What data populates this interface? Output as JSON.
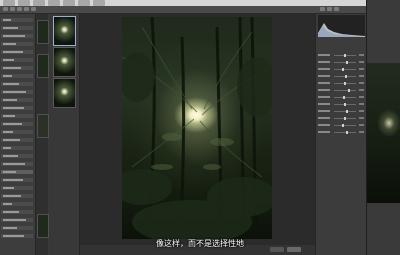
{
  "menubar": {
    "items": [
      "",
      "",
      "",
      "",
      "",
      "",
      ""
    ]
  },
  "left_panel": {
    "rows": 28
  },
  "filmstrip": {
    "thumbnails": 3,
    "selected_index": 0
  },
  "canvas": {
    "photo": "forest-photo"
  },
  "right_panel": {
    "histogram": "histogram",
    "sliders": [
      {
        "level": 0.5
      },
      {
        "level": 0.62
      },
      {
        "level": 0.4
      },
      {
        "level": 0.55
      },
      {
        "level": 0.5
      },
      {
        "level": 0.68
      },
      {
        "level": 0.45
      },
      {
        "level": 0.5
      },
      {
        "level": 0.58
      },
      {
        "level": 0.5
      },
      {
        "level": 0.42
      },
      {
        "level": 0.6
      }
    ]
  },
  "subtitle": {
    "text": "像这样，而不是选择性地"
  },
  "colors": {
    "accent": "#9ab0d0",
    "background": "#3a3a3a",
    "canvas": "#2b2b2b"
  }
}
